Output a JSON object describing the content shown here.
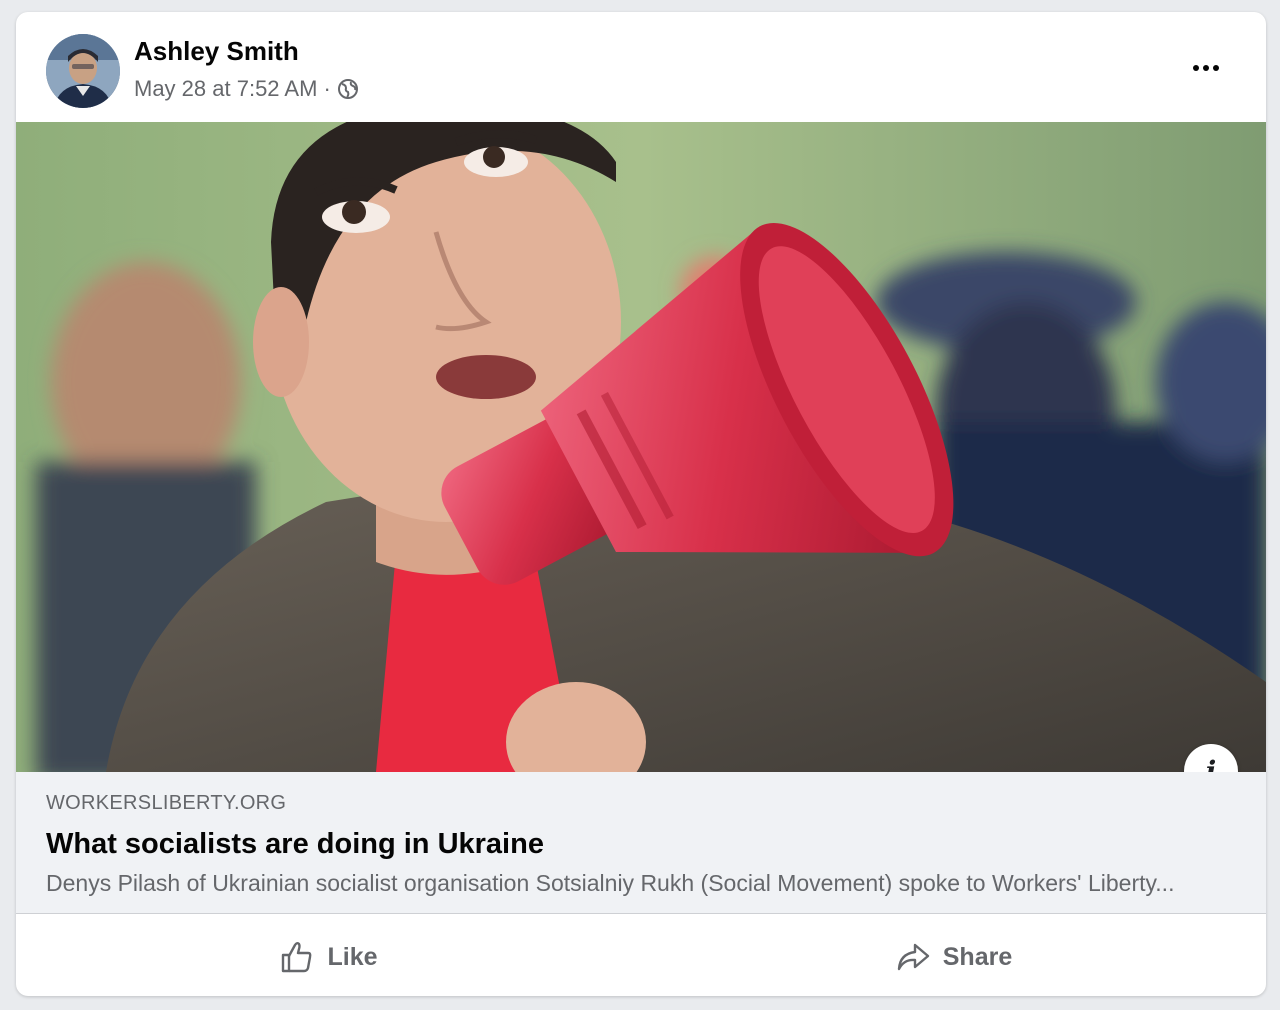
{
  "post": {
    "author": "Ashley Smith",
    "timestamp": "May 28 at 7:52 AM",
    "separator": "·",
    "privacy_icon": "globe-icon",
    "more_icon": "more-options-icon"
  },
  "link": {
    "domain": "WORKERSLIBERTY.ORG",
    "title": "What socialists are doing in Ukraine",
    "description": "Denys Pilash of Ukrainian socialist organisation Sotsialniy Rukh (Social Movement) spoke to Workers' Liberty..."
  },
  "actions": {
    "like_label": "Like",
    "like_icon": "thumbs-up-icon",
    "share_label": "Share",
    "share_icon": "share-arrow-icon"
  },
  "info_icon_label": "i",
  "colors": {
    "text_primary": "#050505",
    "text_secondary": "#65676b",
    "preview_bg": "#f0f2f5",
    "megaphone_red": "#d8304a"
  }
}
